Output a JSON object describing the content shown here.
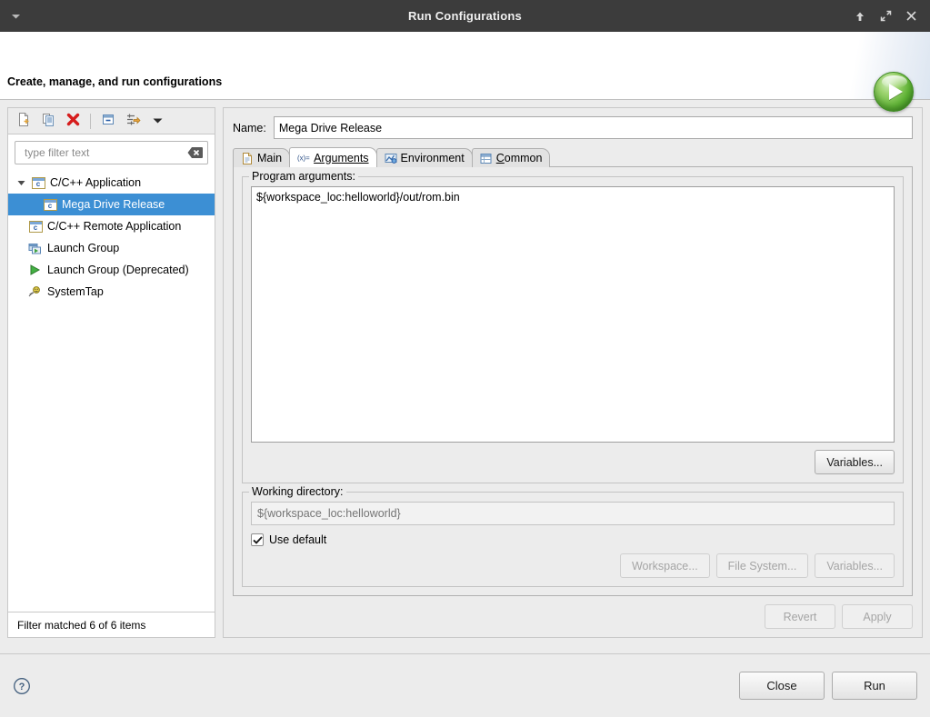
{
  "window": {
    "title": "Run Configurations",
    "caret_icon": "chevron-down-icon",
    "controls": [
      {
        "name": "minimize-button",
        "icon": "arrow-up-icon"
      },
      {
        "name": "maximize-button",
        "icon": "expand-icon"
      },
      {
        "name": "close-button",
        "icon": "close-icon"
      }
    ]
  },
  "banner": {
    "title": "Create, manage, and run configurations",
    "icon": "run-orb-icon"
  },
  "sidebar": {
    "toolbar": [
      {
        "name": "new-configuration-button",
        "icon": "new-document-icon"
      },
      {
        "name": "duplicate-configuration-button",
        "icon": "copy-icon"
      },
      {
        "name": "delete-configuration-button",
        "icon": "red-x-delete-icon"
      },
      {
        "name": "collapse-all-button",
        "icon": "collapse-all-icon"
      },
      {
        "name": "filter-button",
        "icon": "filter-arrow-icon"
      },
      {
        "name": "view-menu-button",
        "icon": "chevron-down-icon"
      }
    ],
    "filter": {
      "placeholder": "type filter text",
      "value": "",
      "clear_icon": "clear-field-icon"
    },
    "tree": [
      {
        "label": "C/C++ Application",
        "icon": "c-launch-icon",
        "level": 0,
        "expanded": true,
        "selected": false
      },
      {
        "label": "Mega Drive Release",
        "icon": "c-launch-icon",
        "level": 1,
        "expanded": false,
        "selected": true
      },
      {
        "label": "C/C++ Remote Application",
        "icon": "c-launch-icon",
        "level": 0,
        "expanded": false,
        "selected": false
      },
      {
        "label": "Launch Group",
        "icon": "launch-group-icon",
        "level": 0,
        "expanded": false,
        "selected": false
      },
      {
        "label": "Launch Group (Deprecated)",
        "icon": "green-play-icon",
        "level": 0,
        "expanded": false,
        "selected": false
      },
      {
        "label": "SystemTap",
        "icon": "systemtap-icon",
        "level": 0,
        "expanded": false,
        "selected": false
      }
    ],
    "status": "Filter matched 6 of 6 items"
  },
  "config": {
    "name_label": "Name:",
    "name_value": "Mega Drive Release",
    "tabs": [
      {
        "label": "Main",
        "icon": "document-icon",
        "active": false,
        "mnemonic": ""
      },
      {
        "label": "Arguments",
        "icon": "variable-icon",
        "active": true,
        "mnemonic": "A"
      },
      {
        "label": "Environment",
        "icon": "environment-icon",
        "active": false,
        "mnemonic": ""
      },
      {
        "label": "Common",
        "icon": "table-icon",
        "active": false,
        "mnemonic": "C"
      }
    ],
    "program_arguments": {
      "group_label": "Program arguments:",
      "value": "${workspace_loc:helloworld}/out/rom.bin",
      "variables_button": "Variables..."
    },
    "working_directory": {
      "group_label": "Working directory:",
      "placeholder": "${workspace_loc:helloworld}",
      "value": "",
      "use_default_label": "Use default",
      "use_default_checked": true,
      "workspace_button": "Workspace...",
      "filesystem_button": "File System...",
      "variables_button": "Variables..."
    },
    "revert_button": "Revert",
    "apply_button": "Apply"
  },
  "footer": {
    "help_icon": "help-icon",
    "close_button": "Close",
    "run_button": "Run"
  },
  "colors": {
    "titlebar": "#3c3c3c",
    "selection": "#3c8fd4",
    "panel": "#ececec",
    "run_green": "#5cb033"
  }
}
